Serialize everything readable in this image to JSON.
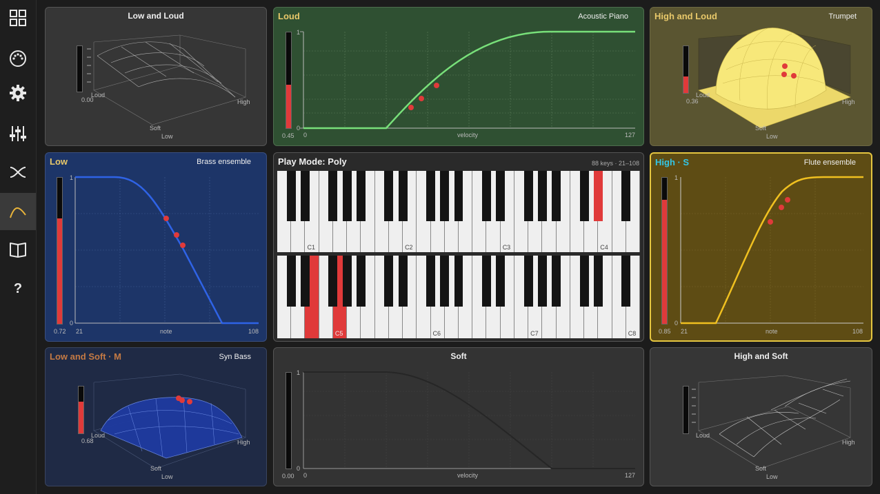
{
  "sidebar": {
    "items": [
      {
        "name": "grid-icon",
        "active": false
      },
      {
        "name": "midi-port-icon",
        "active": false
      },
      {
        "name": "gear-icon",
        "active": false
      },
      {
        "name": "sliders-icon",
        "active": false
      },
      {
        "name": "crossfade-icon",
        "active": false
      },
      {
        "name": "curve-icon",
        "active": true
      },
      {
        "name": "book-icon",
        "active": false
      },
      {
        "name": "help-icon",
        "label": "?",
        "active": false
      }
    ]
  },
  "panels": {
    "low_and_loud": {
      "title": "Low and Loud",
      "meter_value": "0.00",
      "meter_level": 0.0,
      "axis_loud": "Loud",
      "axis_high": "High",
      "axis_soft": "Soft",
      "axis_low": "Low"
    },
    "loud": {
      "title": "Loud",
      "instrument": "Acoustic Piano",
      "meter_value": "0.45",
      "meter_level": 0.45,
      "y_top": "1",
      "y_bottom": "0",
      "x_min": "0",
      "x_label": "velocity",
      "x_max": "127"
    },
    "high_and_loud": {
      "title": "High and Loud",
      "instrument": "Trumpet",
      "meter_value": "0.36",
      "meter_level": 0.36,
      "axis_loud": "Loud",
      "axis_high": "High",
      "axis_soft": "Soft",
      "axis_low": "Low"
    },
    "low": {
      "title": "Low",
      "instrument": "Brass ensemble",
      "meter_value": "0.72",
      "meter_level": 0.72,
      "y_top": "1",
      "y_bottom": "0",
      "x_min": "21",
      "x_label": "note",
      "x_max": "108"
    },
    "play_mode": {
      "title": "Play Mode: Poly",
      "info": "88 keys · 21–108",
      "octave_labels_top": [
        "C1",
        "C2",
        "C3",
        "C4"
      ],
      "octave_labels_bottom": [
        "C5",
        "C6",
        "C7",
        "C8"
      ]
    },
    "high_s": {
      "title": "High · S",
      "instrument": "Flute ensemble",
      "meter_value": "0.85",
      "meter_level": 0.85,
      "y_top": "1",
      "y_bottom": "0",
      "x_min": "21",
      "x_label": "note",
      "x_max": "108"
    },
    "low_and_soft_m": {
      "title": "Low and Soft · M",
      "instrument": "Syn Bass",
      "meter_value": "0.68",
      "meter_level": 0.68,
      "axis_loud": "Loud",
      "axis_high": "High",
      "axis_soft": "Soft",
      "axis_low": "Low"
    },
    "soft": {
      "title": "Soft",
      "meter_value": "0.00",
      "meter_level": 0.0,
      "y_top": "1",
      "y_bottom": "0",
      "x_min": "0",
      "x_label": "velocity",
      "x_max": "127"
    },
    "high_and_soft": {
      "title": "High and Soft",
      "axis_loud": "Loud",
      "axis_high": "High",
      "axis_soft": "Soft",
      "axis_low": "Low"
    }
  },
  "colors": {
    "loud": "#78e07a",
    "low": "#2f63e6",
    "high_s": "#f0c020",
    "active_note": "#e03a3a",
    "title_gold": "#e8c86a",
    "title_cyan": "#33c6e6",
    "title_copper": "#c47a44"
  }
}
